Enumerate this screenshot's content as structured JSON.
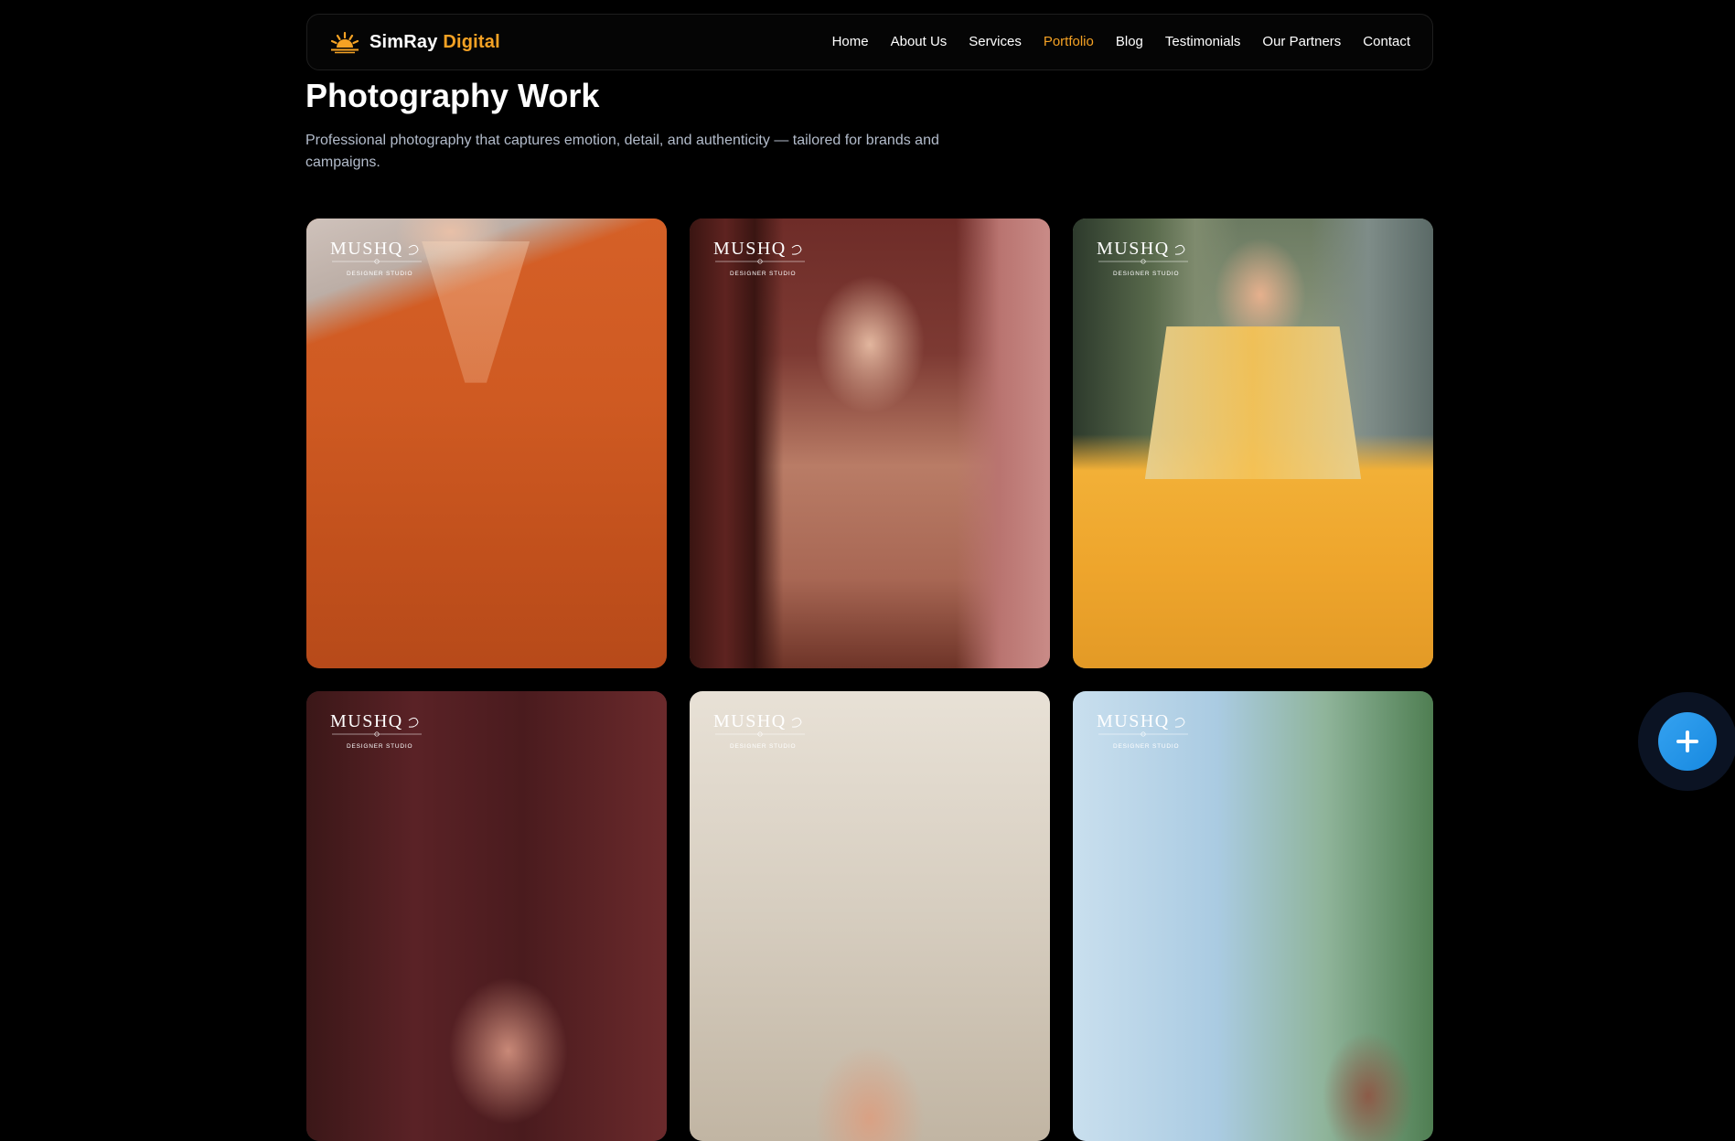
{
  "brand": {
    "name_primary": "SimRay",
    "name_accent": "Digital",
    "logo_icon": "sunrise-icon",
    "accent_color": "#f5a224"
  },
  "nav": {
    "items": [
      {
        "label": "Home",
        "active": false
      },
      {
        "label": "About Us",
        "active": false
      },
      {
        "label": "Services",
        "active": false
      },
      {
        "label": "Portfolio",
        "active": true
      },
      {
        "label": "Blog",
        "active": false
      },
      {
        "label": "Testimonials",
        "active": false
      },
      {
        "label": "Our Partners",
        "active": false
      },
      {
        "label": "Contact",
        "active": false
      }
    ]
  },
  "section": {
    "title": "Photography Work",
    "subtitle": "Professional photography that captures emotion, detail, and authenticity — tailored for brands and campaigns."
  },
  "gallery": {
    "watermark_brand": "MUSHQ",
    "watermark_tagline": "DESIGNER STUDIO",
    "items": [
      {
        "subject": "orange-embroidered-kurta-photo"
      },
      {
        "subject": "peach-embellished-suit-photo"
      },
      {
        "subject": "yellow-lehenga-jacket-photo"
      },
      {
        "subject": "maroon-outfit-portrait-photo"
      },
      {
        "subject": "bridal-maang-tikka-portrait-photo"
      },
      {
        "subject": "outdoor-garden-portrait-photo"
      }
    ]
  },
  "fab": {
    "icon": "plus-icon",
    "color": "#1e90e8"
  }
}
